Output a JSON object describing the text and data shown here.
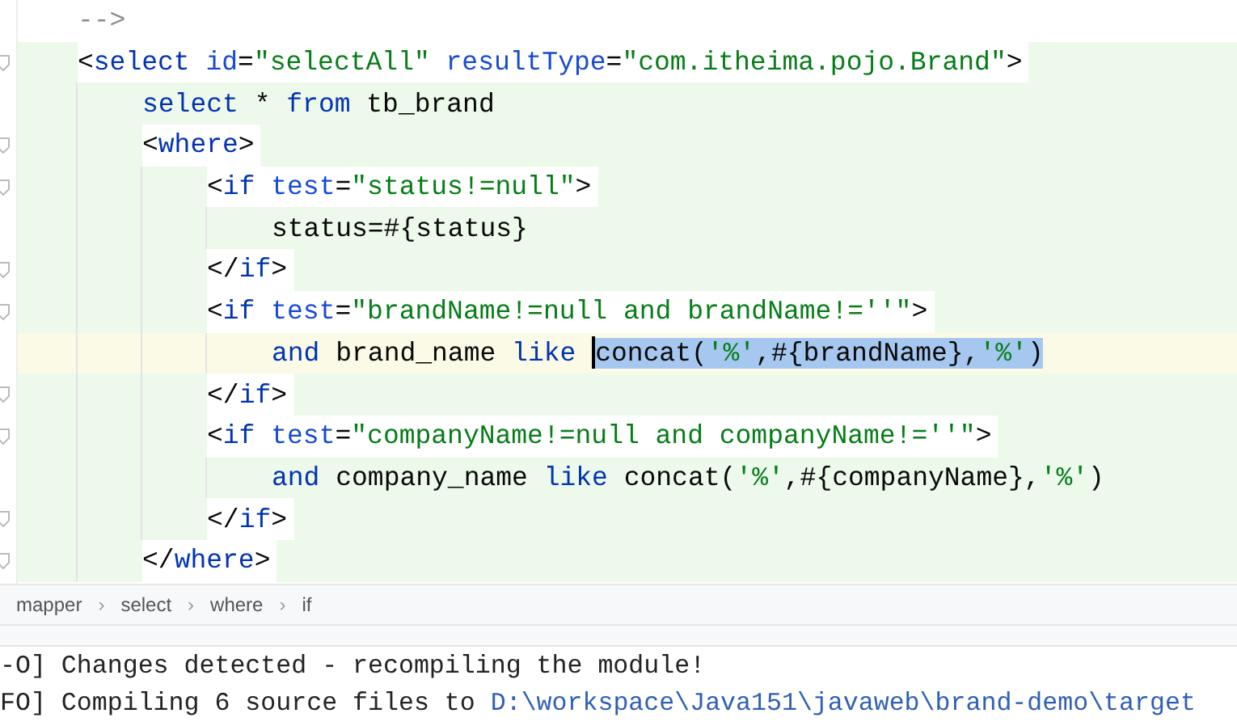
{
  "editor": {
    "lines": [
      {
        "kind": "comment",
        "scoped": false,
        "current": false,
        "tokens": [
          {
            "kind": "comment",
            "text": "-->",
            "selected": false
          }
        ]
      },
      {
        "kind": "tag",
        "scoped": true,
        "current": false,
        "tokens": [
          {
            "kind": "punct",
            "text": "<",
            "selected": false
          },
          {
            "kind": "tag",
            "text": "select",
            "selected": false
          },
          {
            "kind": "attr",
            "text": " id",
            "selected": false
          },
          {
            "kind": "punct",
            "text": "=",
            "selected": false
          },
          {
            "kind": "str",
            "text": "\"selectAll\"",
            "selected": false
          },
          {
            "kind": "attr",
            "text": " resultType",
            "selected": false
          },
          {
            "kind": "punct",
            "text": "=",
            "selected": false
          },
          {
            "kind": "str",
            "text": "\"com.itheima.pojo.Brand\"",
            "selected": false
          },
          {
            "kind": "punct",
            "text": ">",
            "selected": false
          }
        ],
        "children": [
          {
            "kind": "sql",
            "scoped": true,
            "current": false,
            "tokens": [
              {
                "kind": "kw",
                "text": "select",
                "selected": false
              },
              {
                "kind": "text",
                "text": " * ",
                "selected": false
              },
              {
                "kind": "kw",
                "text": "from",
                "selected": false
              },
              {
                "kind": "text",
                "text": " tb_brand",
                "selected": false
              }
            ]
          },
          {
            "kind": "tag",
            "scoped": true,
            "current": false,
            "tokens": [
              {
                "kind": "punct",
                "text": "<",
                "selected": false
              },
              {
                "kind": "tag",
                "text": "where",
                "selected": false
              },
              {
                "kind": "punct",
                "text": ">",
                "selected": false
              }
            ],
            "children": [
              {
                "kind": "tag",
                "scoped": true,
                "current": false,
                "tokens": [
                  {
                    "kind": "punct",
                    "text": "<",
                    "selected": false
                  },
                  {
                    "kind": "tag",
                    "text": "if",
                    "selected": false
                  },
                  {
                    "kind": "attr",
                    "text": " test",
                    "selected": false
                  },
                  {
                    "kind": "punct",
                    "text": "=",
                    "selected": false
                  },
                  {
                    "kind": "str",
                    "text": "\"status!=null\"",
                    "selected": false
                  },
                  {
                    "kind": "punct",
                    "text": ">",
                    "selected": false
                  }
                ],
                "children": [
                  {
                    "kind": "sql",
                    "scoped": true,
                    "current": false,
                    "tokens": [
                      {
                        "kind": "text",
                        "text": "status=#{status}",
                        "selected": false
                      }
                    ]
                  }
                ]
              },
              {
                "kind": "tag",
                "scoped": true,
                "current": false,
                "tokens": [
                  {
                    "kind": "punct",
                    "text": "</",
                    "selected": false
                  },
                  {
                    "kind": "tag",
                    "text": "if",
                    "selected": false
                  },
                  {
                    "kind": "punct",
                    "text": ">",
                    "selected": false
                  }
                ]
              },
              {
                "kind": "tag",
                "scoped": true,
                "current": false,
                "tokens": [
                  {
                    "kind": "punct",
                    "text": "<",
                    "selected": false
                  },
                  {
                    "kind": "tag",
                    "text": "if",
                    "selected": false
                  },
                  {
                    "kind": "attr",
                    "text": " test",
                    "selected": false
                  },
                  {
                    "kind": "punct",
                    "text": "=",
                    "selected": false
                  },
                  {
                    "kind": "str",
                    "text": "\"brandName!=null and brandName!=''\"",
                    "selected": false
                  },
                  {
                    "kind": "punct",
                    "text": ">",
                    "selected": false
                  }
                ],
                "children": [
                  {
                    "kind": "sql",
                    "scoped": true,
                    "current": true,
                    "tokens": [
                      {
                        "kind": "kw",
                        "text": "and",
                        "selected": false
                      },
                      {
                        "kind": "text",
                        "text": " brand_name ",
                        "selected": false
                      },
                      {
                        "kind": "kw",
                        "text": "like ",
                        "selected": false
                      },
                      {
                        "kind": "text",
                        "text": "concat(",
                        "selected": true
                      },
                      {
                        "kind": "str",
                        "text": "'%'",
                        "selected": true
                      },
                      {
                        "kind": "text",
                        "text": ",#{brandName},",
                        "selected": true
                      },
                      {
                        "kind": "str",
                        "text": "'%'",
                        "selected": true
                      },
                      {
                        "kind": "text",
                        "text": ")",
                        "selected": true
                      }
                    ]
                  }
                ]
              },
              {
                "kind": "tag",
                "scoped": true,
                "current": false,
                "tokens": [
                  {
                    "kind": "punct",
                    "text": "</",
                    "selected": false
                  },
                  {
                    "kind": "tag",
                    "text": "if",
                    "selected": false
                  },
                  {
                    "kind": "punct",
                    "text": ">",
                    "selected": false
                  }
                ]
              },
              {
                "kind": "tag",
                "scoped": true,
                "current": false,
                "tokens": [
                  {
                    "kind": "punct",
                    "text": "<",
                    "selected": false
                  },
                  {
                    "kind": "tag",
                    "text": "if",
                    "selected": false
                  },
                  {
                    "kind": "attr",
                    "text": " test",
                    "selected": false
                  },
                  {
                    "kind": "punct",
                    "text": "=",
                    "selected": false
                  },
                  {
                    "kind": "str",
                    "text": "\"companyName!=null and companyName!=''\"",
                    "selected": false
                  },
                  {
                    "kind": "punct",
                    "text": ">",
                    "selected": false
                  }
                ],
                "children": [
                  {
                    "kind": "sql",
                    "scoped": true,
                    "current": false,
                    "tokens": [
                      {
                        "kind": "kw",
                        "text": "and",
                        "selected": false
                      },
                      {
                        "kind": "text",
                        "text": " company_name ",
                        "selected": false
                      },
                      {
                        "kind": "kw",
                        "text": "like",
                        "selected": false
                      },
                      {
                        "kind": "text",
                        "text": " concat(",
                        "selected": false
                      },
                      {
                        "kind": "str",
                        "text": "'%'",
                        "selected": false
                      },
                      {
                        "kind": "text",
                        "text": ",#{companyName},",
                        "selected": false
                      },
                      {
                        "kind": "str",
                        "text": "'%'",
                        "selected": false
                      },
                      {
                        "kind": "text",
                        "text": ")",
                        "selected": false
                      }
                    ]
                  }
                ]
              },
              {
                "kind": "tag",
                "scoped": true,
                "current": false,
                "tokens": [
                  {
                    "kind": "punct",
                    "text": "</",
                    "selected": false
                  },
                  {
                    "kind": "tag",
                    "text": "if",
                    "selected": false
                  },
                  {
                    "kind": "punct",
                    "text": ">",
                    "selected": false
                  }
                ]
              }
            ]
          },
          {
            "kind": "tag",
            "scoped": true,
            "current": false,
            "tokens": [
              {
                "kind": "punct",
                "text": "</",
                "selected": false
              },
              {
                "kind": "tag",
                "text": "where",
                "selected": false
              },
              {
                "kind": "punct",
                "text": ">",
                "selected": false
              }
            ]
          }
        ]
      }
    ]
  },
  "breadcrumbs": {
    "items": [
      "mapper",
      "select",
      "where",
      "if"
    ],
    "separator": "›"
  },
  "console": {
    "lines": [
      [
        {
          "kind": "text",
          "text": "-O] Changes detected - recompiling the module!"
        }
      ],
      [
        {
          "kind": "text",
          "text": "FO] Compiling 6 source files to "
        },
        {
          "kind": "link",
          "text": "D:\\workspace\\Java151\\javaweb\\brand-demo\\target"
        }
      ]
    ]
  }
}
